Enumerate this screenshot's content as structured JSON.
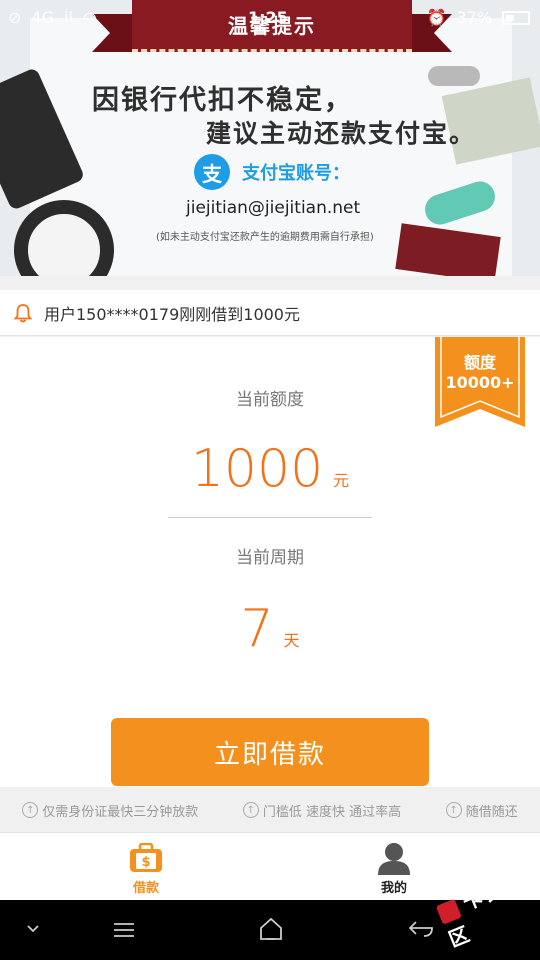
{
  "status_bar": {
    "network": "4G",
    "signal": "il",
    "time": "1:25",
    "battery": "37%"
  },
  "banner": {
    "title": "温馨提示",
    "line1": "因银行代扣不稳定，",
    "line2": "建议主动还款支付宝。",
    "alipay_icon_char": "支",
    "alipay_label": "支付宝账号：",
    "account": "jiejitian@jiejitian.net",
    "note": "(如未主动支付宝还款产生的逾期费用需自行承担)"
  },
  "marquee": {
    "text": "用户150****0179刚刚借到1000元"
  },
  "quota_tag": {
    "line1": "额度",
    "line2": "10000+"
  },
  "loan": {
    "amount_label": "当前额度",
    "amount": "1000",
    "amount_unit": "元",
    "period_label": "当前周期",
    "period": "7",
    "period_unit": "天",
    "button": "立即借款"
  },
  "features": [
    "仅需身份证最快三分钟放款",
    "门槛低 速度快 通过率高",
    "随借随还"
  ],
  "tabs": [
    {
      "label": "借款",
      "active": true
    },
    {
      "label": "我的",
      "active": false
    }
  ],
  "watermark": "卡农社区",
  "colors": {
    "accent": "#f4911e",
    "amount": "#f0721b",
    "ribbon": "#8a1a22",
    "alipay": "#1e9de6"
  }
}
